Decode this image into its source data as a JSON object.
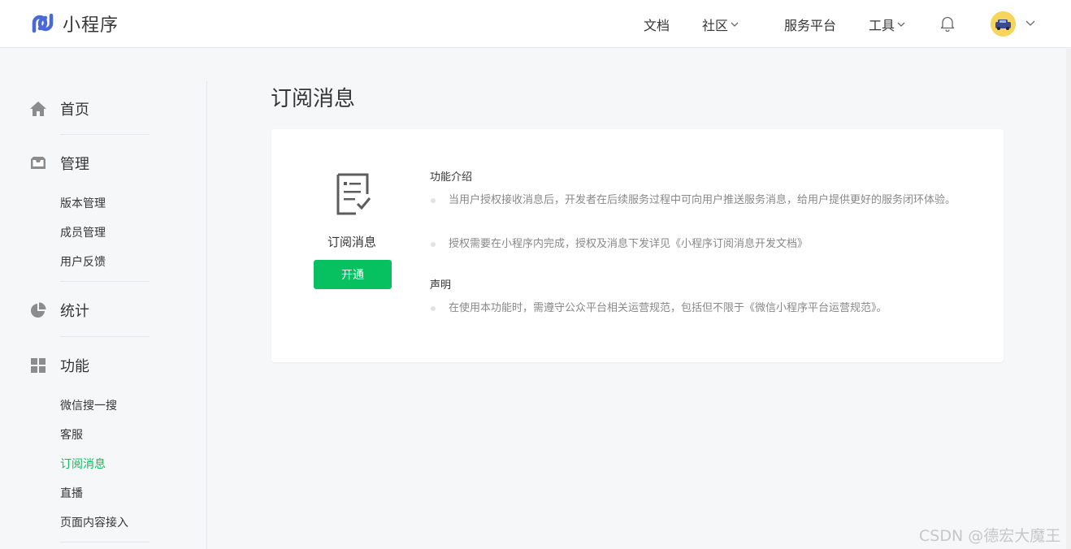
{
  "header": {
    "logo_text": "小程序",
    "nav": {
      "docs": "文档",
      "community": "社区",
      "service_platform": "服务平台",
      "tools": "工具"
    }
  },
  "sidebar": {
    "home": "首页",
    "manage": {
      "label": "管理",
      "items": [
        "版本管理",
        "成员管理",
        "用户反馈"
      ]
    },
    "stats": "统计",
    "features": {
      "label": "功能",
      "items": [
        "微信搜一搜",
        "客服",
        "订阅消息",
        "直播",
        "页面内容接入"
      ],
      "active_index": 2
    }
  },
  "main": {
    "title": "订阅消息",
    "card": {
      "feature_name": "订阅消息",
      "open_button": "开通",
      "intro_title": "功能介绍",
      "intro_points": [
        "当用户授权接收消息后，开发者在后续服务过程中可向用户推送服务消息，给用户提供更好的服务闭环体验。",
        "授权需要在小程序内完成，授权及消息下发详见《小程序订阅消息开发文档》"
      ],
      "notice_title": "声明",
      "notice_points": [
        "在使用本功能时，需遵守公众平台相关运营规范，包括但不限于《微信小程序平台运营规范》。"
      ]
    }
  },
  "watermark": "CSDN @德宏大魔王",
  "colors": {
    "accent": "#07c160",
    "logo": "#4a69d8",
    "icon_gray": "#8c8c8c"
  },
  "icons": [
    "logo-icon",
    "bell-icon",
    "avatar-icon",
    "home-icon",
    "inbox-icon",
    "pie-chart-icon",
    "grid-icon",
    "document-check-icon",
    "chevron-down-icon"
  ]
}
